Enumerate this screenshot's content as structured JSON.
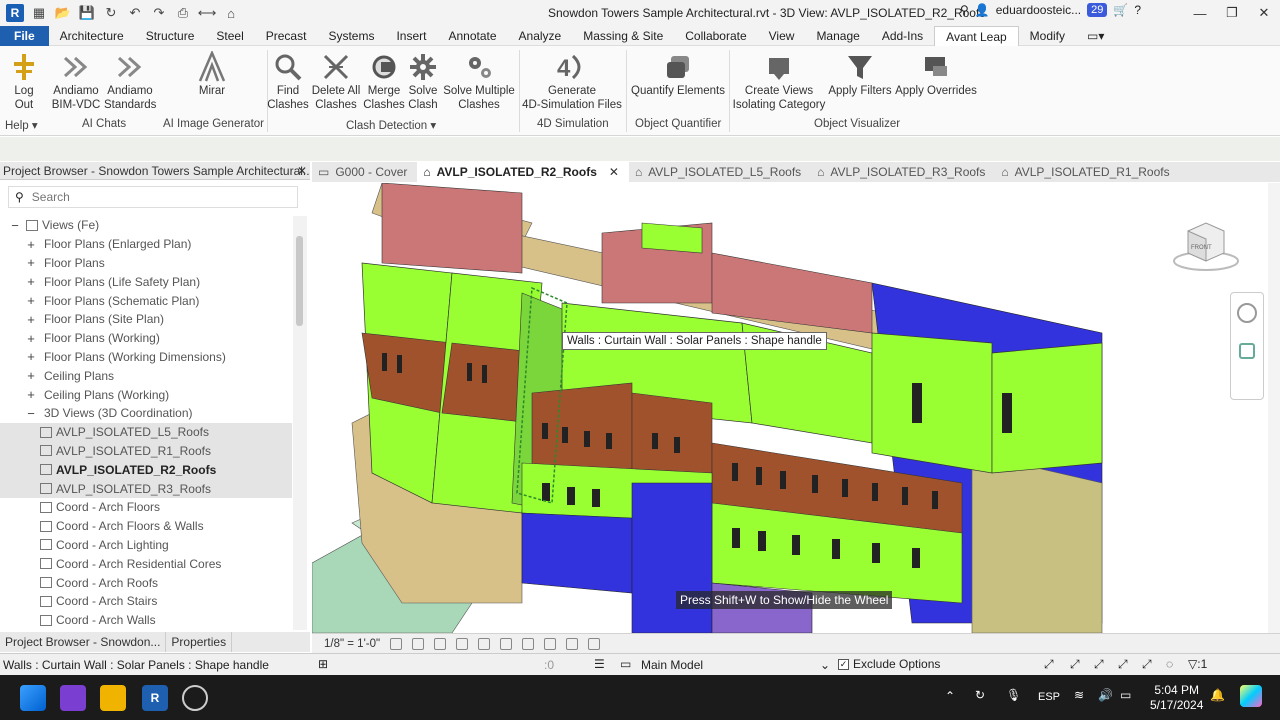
{
  "titlebar": {
    "doc_title": "Snowdon Towers Sample Architectural.rvt - 3D View: AVLP_ISOLATED_R2_Roofs",
    "user": "eduardoosteic...",
    "notif_count": "29"
  },
  "tabs": [
    "File",
    "Architecture",
    "Structure",
    "Steel",
    "Precast",
    "Systems",
    "Insert",
    "Annotate",
    "Analyze",
    "Massing & Site",
    "Collaborate",
    "View",
    "Manage",
    "Add-Ins",
    "Avant Leap",
    "Modify"
  ],
  "ribbon": {
    "tools": {
      "logout": "Log\nOut",
      "andiamo_bim": "Andiamo\nBIM-VDC",
      "andiamo_std": "Andiamo\nStandards",
      "mirar": "Mirar",
      "find_clashes": "Find\nClashes",
      "delete_clashes": "Delete All\nClashes",
      "merge_clashes": "Merge\nClashes",
      "solve_clash": "Solve\nClash",
      "solve_multiple": "Solve Multiple\nClashes",
      "generate_4d": "Generate\n4D-Simulation Files",
      "quantify": "Quantify Elements",
      "create_views": "Create Views\nIsolating Category",
      "apply_filters": "Apply Filters",
      "apply_overrides": "Apply Overrides"
    },
    "panels": {
      "help": "Help",
      "ai_chats": "AI Chats",
      "ai_image": "AI Image Generator",
      "clash": "Clash Detection",
      "sim": "4D Simulation",
      "quant": "Object Quantifier",
      "visualizer": "Object Visualizer"
    }
  },
  "project_browser": {
    "title": "Project Browser - Snowdon Towers Sample Architectural....",
    "search_placeholder": "Search",
    "items": [
      {
        "label": "Views (Fe)",
        "toggle": "−",
        "indent": 0,
        "type": "root"
      },
      {
        "label": "Floor Plans (Enlarged Plan)",
        "toggle": "+",
        "indent": 1
      },
      {
        "label": "Floor Plans",
        "toggle": "+",
        "indent": 1
      },
      {
        "label": "Floor Plans (Life Safety Plan)",
        "toggle": "+",
        "indent": 1
      },
      {
        "label": "Floor Plans (Schematic Plan)",
        "toggle": "+",
        "indent": 1
      },
      {
        "label": "Floor Plans (Site Plan)",
        "toggle": "+",
        "indent": 1
      },
      {
        "label": "Floor Plans (Working)",
        "toggle": "+",
        "indent": 1
      },
      {
        "label": "Floor Plans (Working Dimensions)",
        "toggle": "+",
        "indent": 1
      },
      {
        "label": "Ceiling Plans",
        "toggle": "+",
        "indent": 1
      },
      {
        "label": "Ceiling Plans (Working)",
        "toggle": "+",
        "indent": 1
      },
      {
        "label": "3D Views (3D Coordination)",
        "toggle": "−",
        "indent": 1
      },
      {
        "label": "AVLP_ISOLATED_L5_Roofs",
        "toggle": "",
        "indent": 2,
        "type": "view",
        "sel": true
      },
      {
        "label": "AVLP_ISOLATED_R1_Roofs",
        "toggle": "",
        "indent": 2,
        "type": "view",
        "sel": true
      },
      {
        "label": "AVLP_ISOLATED_R2_Roofs",
        "toggle": "",
        "indent": 2,
        "type": "view",
        "sel": true,
        "bold": true
      },
      {
        "label": "AVLP_ISOLATED_R3_Roofs",
        "toggle": "",
        "indent": 2,
        "type": "view",
        "sel": true
      },
      {
        "label": "Coord - Arch Floors",
        "toggle": "",
        "indent": 2,
        "type": "view"
      },
      {
        "label": "Coord - Arch Floors & Walls",
        "toggle": "",
        "indent": 2,
        "type": "view"
      },
      {
        "label": "Coord - Arch Lighting",
        "toggle": "",
        "indent": 2,
        "type": "view"
      },
      {
        "label": "Coord - Arch Residential Cores",
        "toggle": "",
        "indent": 2,
        "type": "view"
      },
      {
        "label": "Coord - Arch Roofs",
        "toggle": "",
        "indent": 2,
        "type": "view"
      },
      {
        "label": "Coord - Arch Stairs",
        "toggle": "",
        "indent": 2,
        "type": "view"
      },
      {
        "label": "Coord - Arch Walls",
        "toggle": "",
        "indent": 2,
        "type": "view"
      }
    ],
    "bottom_tabs": [
      "Project Browser - Snowdon...",
      "Properties"
    ]
  },
  "view_tabs": [
    {
      "label": "G000 - Cover",
      "active": false
    },
    {
      "label": "AVLP_ISOLATED_R2_Roofs",
      "active": true
    },
    {
      "label": "AVLP_ISOLATED_L5_Roofs",
      "active": false
    },
    {
      "label": "AVLP_ISOLATED_R3_Roofs",
      "active": false
    },
    {
      "label": "AVLP_ISOLATED_R1_Roofs",
      "active": false
    }
  ],
  "viewport": {
    "tooltip": "Walls : Curtain Wall : Solar Panels : Shape handle",
    "hint": "Press Shift+W to Show/Hide the Wheel",
    "viewcube_label": "FRONT",
    "colors": {
      "green": "#99ff33",
      "red": "#cc7777",
      "blue": "#3333dd",
      "tan": "#d8c089",
      "olive": "#c8c080",
      "brown": "#a0522d",
      "mint": "#a8d8b8"
    }
  },
  "view_control": {
    "scale": "1/8\" = 1'-0\""
  },
  "status": {
    "text": "Walls : Curtain Wall : Solar Panels : Shape handle",
    "zero1": ":0",
    "model": "Main Model",
    "exclude": "Exclude Options",
    "filter": ":1"
  },
  "taskbar": {
    "lang": "ESP",
    "time": "5:04 PM",
    "date": "5/17/2024"
  }
}
